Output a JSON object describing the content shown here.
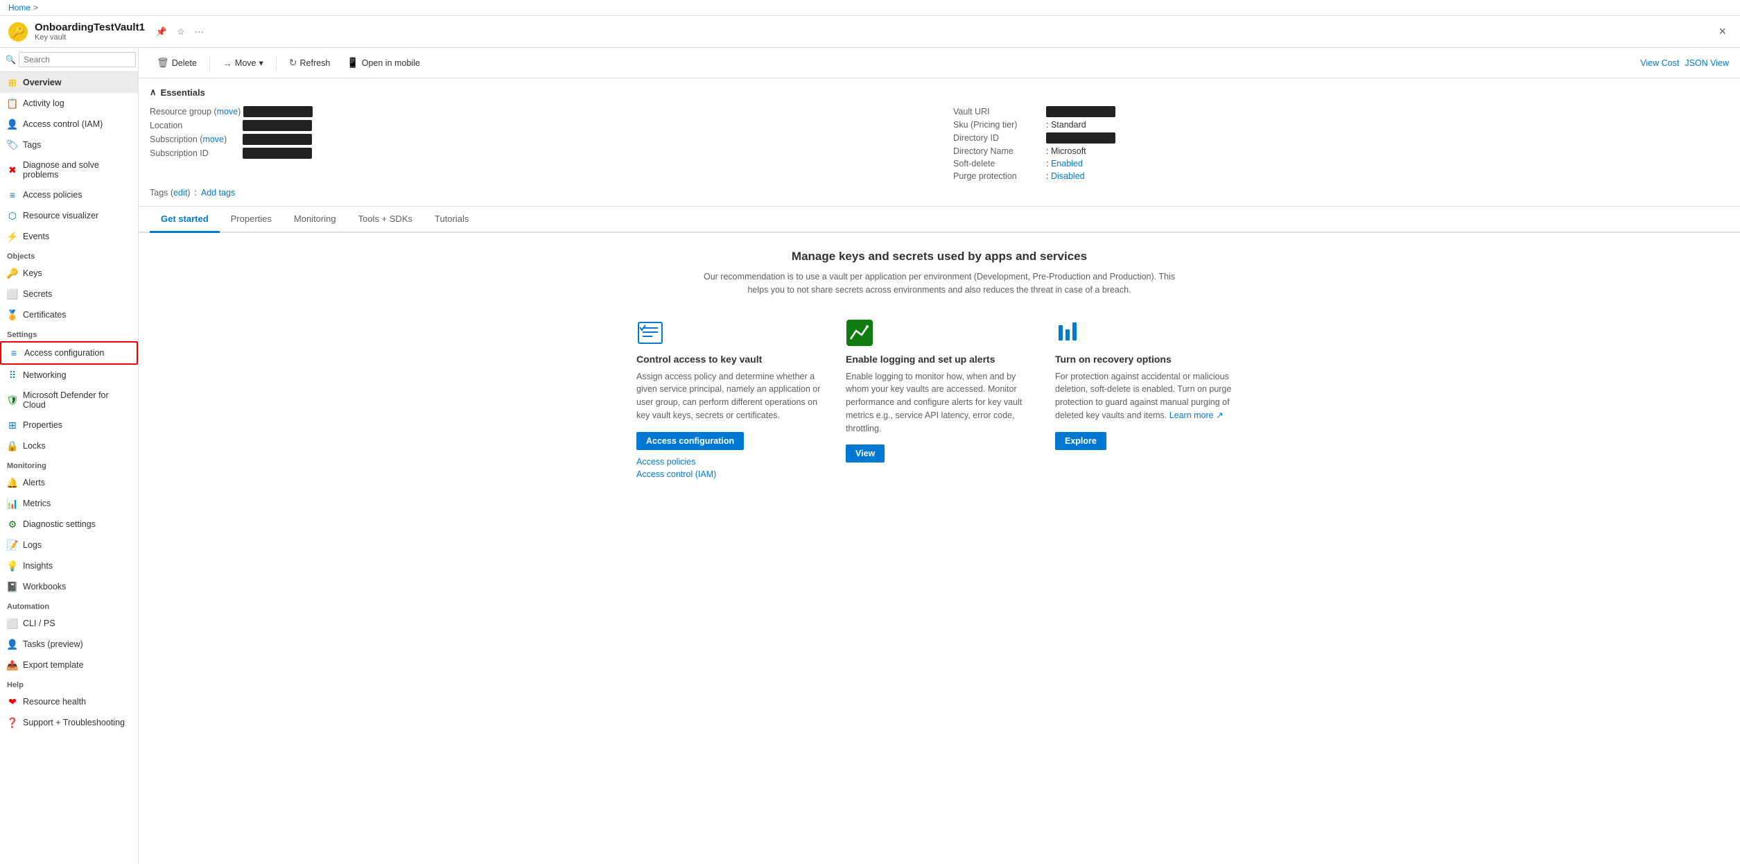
{
  "breadcrumb": {
    "home": "Home",
    "separator": ">"
  },
  "header": {
    "icon": "🔑",
    "title": "OnboardingTestVault1",
    "subtitle": "Key vault",
    "actions": {
      "pin": "📌",
      "star": "☆",
      "more": "..."
    },
    "close": "×"
  },
  "toolbar": {
    "delete": "Delete",
    "move": "Move",
    "move_chevron": "▾",
    "refresh": "Refresh",
    "open_mobile": "Open in mobile",
    "view_cost": "View Cost",
    "json_view": "JSON View"
  },
  "essentials": {
    "collapsed_icon": "∧",
    "title": "Essentials",
    "left_fields": [
      {
        "label": "Resource group",
        "value_redacted": true,
        "has_move": true,
        "move_text": "move"
      },
      {
        "label": "Location",
        "value_redacted": true,
        "has_move": false
      },
      {
        "label": "Subscription",
        "value_redacted": true,
        "has_move": true,
        "move_text": "move"
      },
      {
        "label": "Subscription ID",
        "value_redacted": true,
        "has_move": false
      }
    ],
    "right_fields": [
      {
        "label": "Vault URI",
        "value_redacted": true
      },
      {
        "label": "Sku (Pricing tier)",
        "value": "Standard"
      },
      {
        "label": "Directory ID",
        "value_redacted": true
      },
      {
        "label": "Directory Name",
        "value": "Microsoft"
      },
      {
        "label": "Soft-delete",
        "value": "Enabled",
        "is_link": true
      },
      {
        "label": "Purge protection",
        "value": "Disabled",
        "is_link": true
      }
    ],
    "tags": {
      "label": "Tags (edit)",
      "edit_text": "edit",
      "add_link": "Add tags"
    }
  },
  "tabs": [
    {
      "id": "get-started",
      "label": "Get started",
      "active": true
    },
    {
      "id": "properties",
      "label": "Properties",
      "active": false
    },
    {
      "id": "monitoring",
      "label": "Monitoring",
      "active": false
    },
    {
      "id": "tools-sdks",
      "label": "Tools + SDKs",
      "active": false
    },
    {
      "id": "tutorials",
      "label": "Tutorials",
      "active": false
    }
  ],
  "get_started": {
    "title": "Manage keys and secrets used by apps and services",
    "subtitle": "Our recommendation is to use a vault per application per environment (Development, Pre-Production and Production). This helps you to not share secrets across environments and also reduces the threat in case of a breach.",
    "cards": [
      {
        "id": "control-access",
        "icon_type": "checklist",
        "title": "Control access to key vault",
        "description": "Assign access policy and determine whether a given service principal, namely an application or user group, can perform different operations on key vault keys, secrets or certificates.",
        "primary_btn": "Access configuration",
        "links": [
          "Access policies",
          "Access control (IAM)"
        ]
      },
      {
        "id": "enable-logging",
        "icon_type": "graph",
        "title": "Enable logging and set up alerts",
        "description": "Enable logging to monitor how, when and by whom your key vaults are accessed. Monitor performance and configure alerts for key vault metrics e.g., service API latency, error code, throttling.",
        "primary_btn": "View",
        "links": []
      },
      {
        "id": "recovery-options",
        "icon_type": "bars",
        "title": "Turn on recovery options",
        "description": "For protection against accidental or malicious deletion, soft-delete is enabled. Turn on purge protection to guard against manual purging of deleted key vaults and items.",
        "learn_more": "Learn more",
        "primary_btn": "Explore",
        "links": []
      }
    ]
  },
  "sidebar": {
    "search_placeholder": "Search",
    "items": [
      {
        "id": "overview",
        "label": "Overview",
        "icon": "⊞",
        "icon_color": "#f5c518",
        "active": true,
        "section": null
      },
      {
        "id": "activity-log",
        "label": "Activity log",
        "icon": "📋",
        "icon_color": "#0078d4",
        "section": null
      },
      {
        "id": "access-control-iam",
        "label": "Access control (IAM)",
        "icon": "👤",
        "icon_color": "#0078d4",
        "section": null
      },
      {
        "id": "tags",
        "label": "Tags",
        "icon": "🏷",
        "icon_color": "#0078d4",
        "section": null
      },
      {
        "id": "diagnose",
        "label": "Diagnose and solve problems",
        "icon": "✖",
        "icon_color": "#e00",
        "section": null
      },
      {
        "id": "access-policies",
        "label": "Access policies",
        "icon": "≡",
        "icon_color": "#0078d4",
        "section": null
      },
      {
        "id": "resource-visualizer",
        "label": "Resource visualizer",
        "icon": "⬡",
        "icon_color": "#0078d4",
        "section": null
      },
      {
        "id": "events",
        "label": "Events",
        "icon": "⚡",
        "icon_color": "#f5c518",
        "section": null
      },
      {
        "id": "section-objects",
        "label": "Objects",
        "type": "section"
      },
      {
        "id": "keys",
        "label": "Keys",
        "icon": "🔑",
        "icon_color": "#f5c518",
        "section": "Objects"
      },
      {
        "id": "secrets",
        "label": "Secrets",
        "icon": "⬜",
        "icon_color": "#0078d4",
        "section": "Objects"
      },
      {
        "id": "certificates",
        "label": "Certificates",
        "icon": "🏅",
        "icon_color": "#0078d4",
        "section": "Objects"
      },
      {
        "id": "section-settings",
        "label": "Settings",
        "type": "section"
      },
      {
        "id": "access-configuration",
        "label": "Access configuration",
        "icon": "≡",
        "icon_color": "#0078d4",
        "section": "Settings",
        "selected": true
      },
      {
        "id": "networking",
        "label": "Networking",
        "icon": "⠿",
        "icon_color": "#0078d4",
        "section": "Settings"
      },
      {
        "id": "defender-cloud",
        "label": "Microsoft Defender for Cloud",
        "icon": "🛡",
        "icon_color": "#107c10",
        "section": "Settings"
      },
      {
        "id": "properties",
        "label": "Properties",
        "icon": "⊞",
        "icon_color": "#0078d4",
        "section": "Settings"
      },
      {
        "id": "locks",
        "label": "Locks",
        "icon": "🔒",
        "icon_color": "#0078d4",
        "section": "Settings"
      },
      {
        "id": "section-monitoring",
        "label": "Monitoring",
        "type": "section"
      },
      {
        "id": "alerts",
        "label": "Alerts",
        "icon": "🔔",
        "icon_color": "#0078d4",
        "section": "Monitoring"
      },
      {
        "id": "metrics",
        "label": "Metrics",
        "icon": "📊",
        "icon_color": "#107c10",
        "section": "Monitoring"
      },
      {
        "id": "diagnostic-settings",
        "label": "Diagnostic settings",
        "icon": "⚙",
        "icon_color": "#107c10",
        "section": "Monitoring"
      },
      {
        "id": "logs",
        "label": "Logs",
        "icon": "📝",
        "icon_color": "#0078d4",
        "section": "Monitoring"
      },
      {
        "id": "insights",
        "label": "Insights",
        "icon": "💡",
        "icon_color": "#f5c518",
        "section": "Monitoring"
      },
      {
        "id": "workbooks",
        "label": "Workbooks",
        "icon": "📓",
        "icon_color": "#0078d4",
        "section": "Monitoring"
      },
      {
        "id": "section-automation",
        "label": "Automation",
        "type": "section"
      },
      {
        "id": "cli-ps",
        "label": "CLI / PS",
        "icon": "⬜",
        "icon_color": "#0078d4",
        "section": "Automation"
      },
      {
        "id": "tasks-preview",
        "label": "Tasks (preview)",
        "icon": "👤",
        "icon_color": "#0078d4",
        "section": "Automation"
      },
      {
        "id": "export-template",
        "label": "Export template",
        "icon": "📤",
        "icon_color": "#0078d4",
        "section": "Automation"
      },
      {
        "id": "section-help",
        "label": "Help",
        "type": "section"
      },
      {
        "id": "resource-health",
        "label": "Resource health",
        "icon": "❤",
        "icon_color": "#e00",
        "section": "Help"
      },
      {
        "id": "support-troubleshooting",
        "label": "Support + Troubleshooting",
        "icon": "❓",
        "icon_color": "#0078d4",
        "section": "Help"
      }
    ]
  }
}
